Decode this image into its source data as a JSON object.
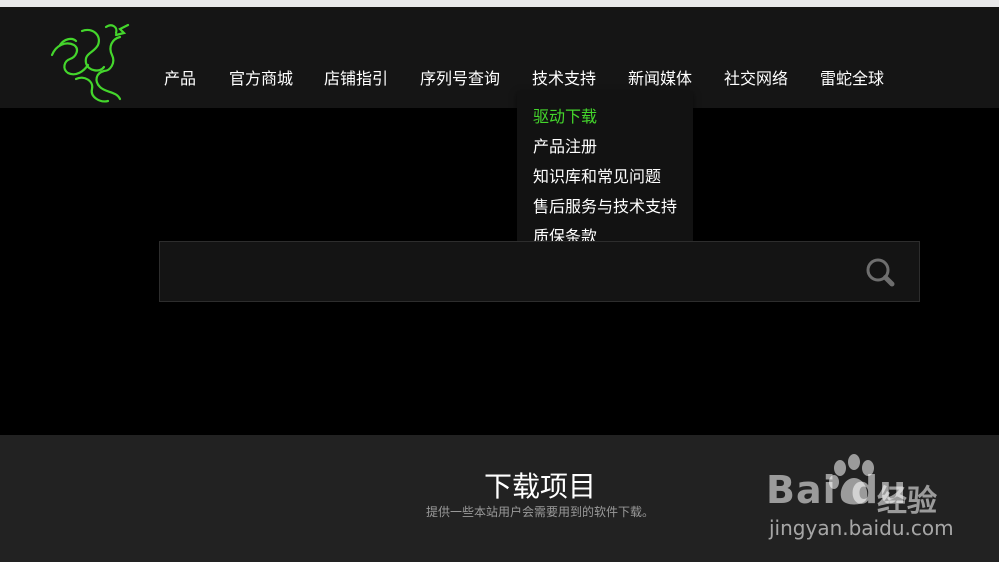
{
  "nav": {
    "items": [
      "产品",
      "官方商城",
      "店铺指引",
      "序列号查询",
      "技术支持",
      "新闻媒体",
      "社交网络",
      "雷蛇全球"
    ]
  },
  "dropdown": {
    "items": [
      "驱动下载",
      "产品注册",
      "知识库和常见问题",
      "售后服务与技术支持",
      "质保条款"
    ],
    "active_index": 0
  },
  "search": {
    "value": "",
    "placeholder": ""
  },
  "section": {
    "title": "下载项目",
    "subtitle": "提供一些本站用户会需要用到的软件下载。"
  },
  "watermark": {
    "brand": "Bai du",
    "product": "经验",
    "url": "jingyan.baidu.com"
  },
  "colors": {
    "accent_green": "#44d62c",
    "header_bg": "#151515",
    "section_bg": "#222222"
  },
  "icons": {
    "logo": "razer-logo",
    "search": "search-icon"
  }
}
